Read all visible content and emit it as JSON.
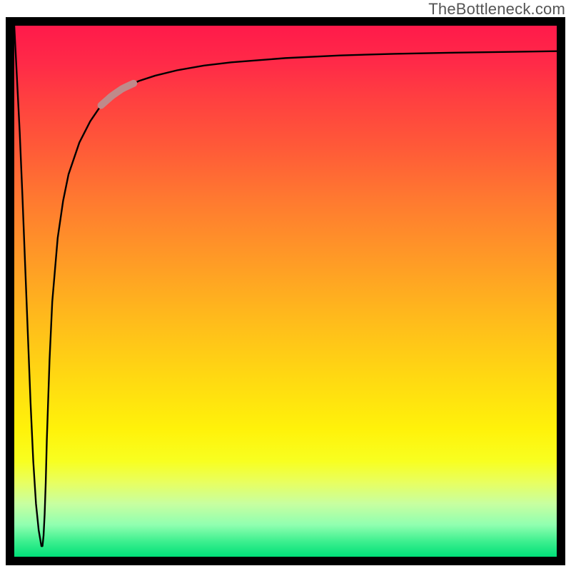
{
  "watermark": "TheBottleneck.com",
  "colors": {
    "border": "#000000",
    "curve": "#000000",
    "highlight": "#bf8a8a",
    "gradient_top": "#ff1a4a",
    "gradient_bottom": "#00e078"
  },
  "chart_data": {
    "type": "line",
    "title": "",
    "xlabel": "",
    "ylabel": "",
    "xlim": [
      0,
      100
    ],
    "ylim": [
      0,
      100
    ],
    "grid": false,
    "legend": false,
    "series": [
      {
        "name": "bottleneck_curve",
        "x": [
          0.0,
          0.5,
          1.0,
          1.5,
          2.0,
          2.5,
          3.0,
          3.5,
          4.0,
          4.5,
          5.0,
          5.2,
          5.4,
          5.6,
          5.8,
          6.0,
          6.5,
          7.0,
          8.0,
          9.0,
          10.0,
          12.0,
          14.0,
          16.0,
          18.0,
          20.0,
          23.0,
          26.0,
          30.0,
          35.0,
          40.0,
          50.0,
          60.0,
          70.0,
          80.0,
          90.0,
          100.0
        ],
        "y": [
          100.0,
          90.0,
          80.0,
          68.0,
          55.0,
          42.0,
          29.0,
          18.0,
          10.0,
          5.0,
          2.0,
          2.0,
          4.0,
          8.0,
          14.0,
          22.0,
          37.0,
          48.0,
          60.0,
          67.0,
          72.0,
          78.0,
          82.0,
          85.0,
          86.8,
          88.2,
          89.6,
          90.6,
          91.6,
          92.5,
          93.1,
          93.9,
          94.4,
          94.7,
          94.9,
          95.05,
          95.2
        ]
      }
    ],
    "highlight_segment": {
      "series": "bottleneck_curve",
      "x_start": 16.0,
      "x_end": 22.0
    }
  }
}
